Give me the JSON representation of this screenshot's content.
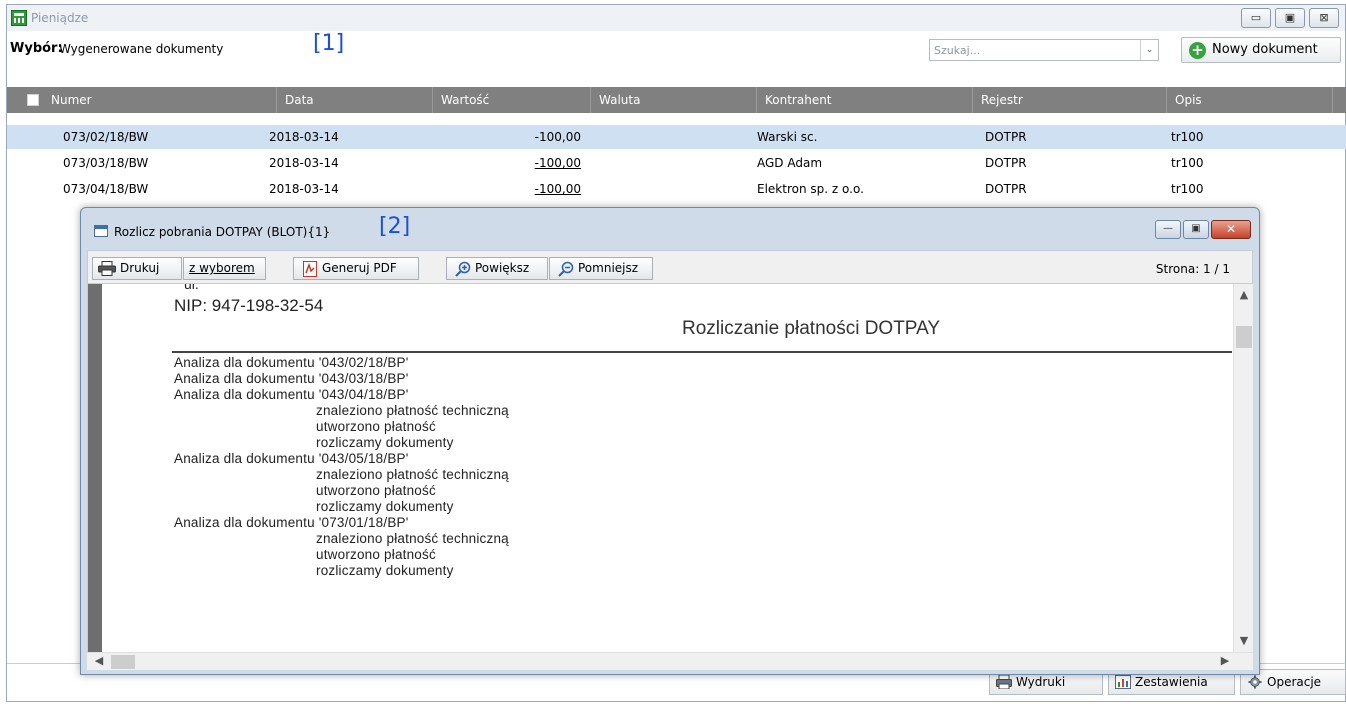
{
  "main_window": {
    "title": "Pieniądze",
    "buttons": {
      "minimize": "▭",
      "maximize": "▣",
      "close": "⊠"
    }
  },
  "filter": {
    "label": "Wybór:",
    "value": "Wygenerowane dokumenty",
    "marker": "[1]",
    "search_placeholder": "Szukaj...",
    "search_dropdown": "⌄",
    "new_doc_label": "Nowy dokument"
  },
  "grid": {
    "columns": [
      "Numer",
      "Data",
      "Wartość",
      "Waluta",
      "Kontrahent",
      "Rejestr",
      "Opis"
    ],
    "rows": [
      {
        "numer": "073/02/18/BW",
        "data": "2018-03-14",
        "wartosc": "-100,00",
        "waluta": "",
        "kontrahent": "Warski sc.",
        "rejestr": "DOTPR",
        "opis": "tr100"
      },
      {
        "numer": "073/03/18/BW",
        "data": "2018-03-14",
        "wartosc": "-100,00",
        "waluta": "",
        "kontrahent": "AGD Adam",
        "rejestr": "DOTPR",
        "opis": "tr100"
      },
      {
        "numer": "073/04/18/BW",
        "data": "2018-03-14",
        "wartosc": "-100,00",
        "waluta": "",
        "kontrahent": "Elektron sp. z o.o.",
        "rejestr": "DOTPR",
        "opis": "tr100"
      }
    ]
  },
  "bottom_buttons": {
    "wydruki": "Wydruki",
    "zestawienia": "Zestawienia",
    "operacje": "Operacje"
  },
  "report_window": {
    "title": "Rozlicz pobrania DOTPAY (BLOT){1}",
    "marker": "[2]",
    "buttons": {
      "minimize": "—",
      "maximize": "▣",
      "close": "✕"
    },
    "toolbar": {
      "print": "Drukuj",
      "with_selection": "z wyborem",
      "pdf": "Generuj PDF",
      "zoom_in": "Powiększ",
      "zoom_out": "Pomniejsz",
      "page_indicator": "Strona: 1 / 1"
    },
    "document": {
      "partial_top": "ul.",
      "nip": "NIP: 947-198-32-54",
      "title": "Rozliczanie płatności DOTPAY",
      "lines": [
        {
          "text": "Analiza dla dokumentu '043/02/18/BP'",
          "indent": false
        },
        {
          "text": "Analiza dla dokumentu '043/03/18/BP'",
          "indent": false
        },
        {
          "text": "Analiza dla dokumentu '043/04/18/BP'",
          "indent": false
        },
        {
          "text": "znaleziono płatność techniczną",
          "indent": true
        },
        {
          "text": "utworzono płatność",
          "indent": true
        },
        {
          "text": "rozliczamy dokumenty",
          "indent": true
        },
        {
          "text": "Analiza dla dokumentu '043/05/18/BP'",
          "indent": false
        },
        {
          "text": "znaleziono płatność techniczną",
          "indent": true
        },
        {
          "text": "utworzono płatność",
          "indent": true
        },
        {
          "text": "rozliczamy dokumenty",
          "indent": true
        },
        {
          "text": "Analiza dla dokumentu '073/01/18/BP'",
          "indent": false
        },
        {
          "text": "znaleziono płatność techniczną",
          "indent": true
        },
        {
          "text": "utworzono płatność",
          "indent": true
        },
        {
          "text": "rozliczamy dokumenty",
          "indent": true
        }
      ]
    }
  }
}
